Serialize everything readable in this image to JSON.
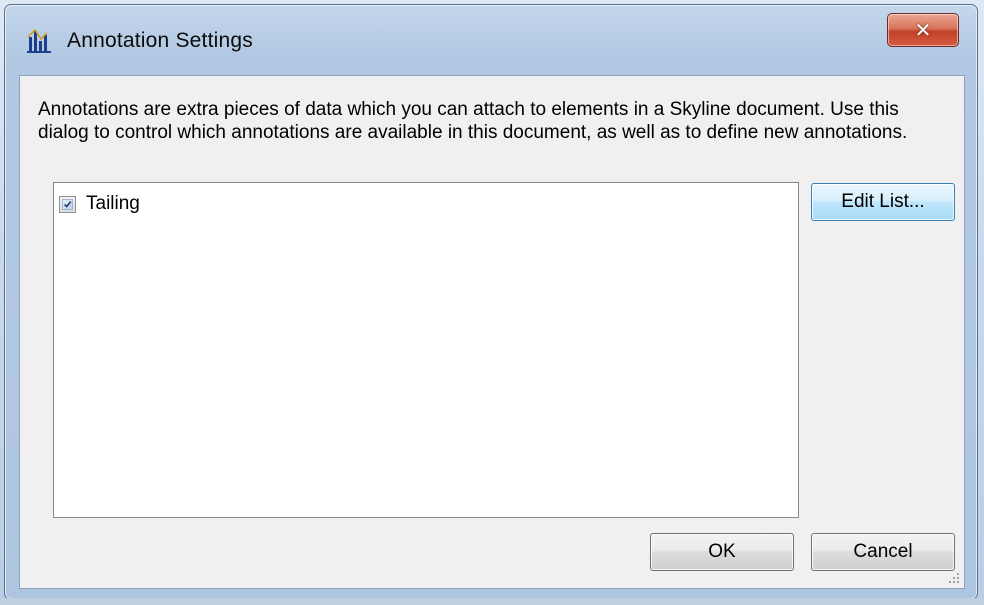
{
  "window": {
    "title": "Annotation Settings",
    "icon": "skyline-app-icon",
    "close_glyph": "✕"
  },
  "description": "Annotations are extra pieces of data which you can attach to elements in a Skyline document. Use this dialog to control which annotations are available in this document, as well as to define new annotations.",
  "annotations_list": {
    "items": [
      {
        "label": "Tailing",
        "checked": true
      }
    ]
  },
  "buttons": {
    "edit_list": "Edit List...",
    "ok": "OK",
    "cancel": "Cancel"
  },
  "colors": {
    "title_bar": "#b3c9e3",
    "close_button": "#c3402a",
    "client_background": "#f0f0f0",
    "default_button_border": "#3c7fb1"
  }
}
